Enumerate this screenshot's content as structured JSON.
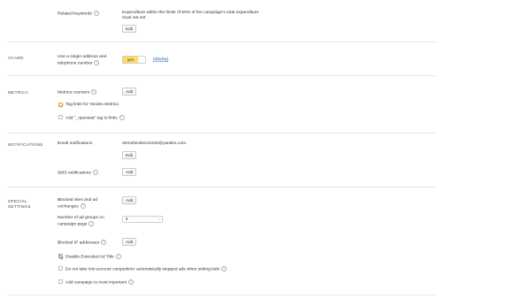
{
  "related_keywords": {
    "label": "Related keywords",
    "desc_line1": "Expenditure within the limits of 50% of the campaign's total expenditure",
    "desc_line2": "Goal not set",
    "edit_button": "Edit"
  },
  "vcard": {
    "section": "VCARD",
    "label_line1": "Use a single address and",
    "label_line2": "telephone number",
    "toggle_value": "yes",
    "link": "(display)"
  },
  "metrica": {
    "section": "METRICA",
    "counters_label": "Metrica counters",
    "add_button": "Add",
    "tag_links_label": "Tag links for Yandex.Metrica",
    "tag_links_checked": true,
    "openstat_label": "Add \"_openstat\" tag to links",
    "openstat_checked": false
  },
  "notifications": {
    "section": "NOTIFICATIONS",
    "email_label": "Email notifications",
    "email_value": "demofordirect1234@yandex.com",
    "edit_button": "Edit",
    "sms_label": "SMS notifications",
    "add_button": "Add"
  },
  "special": {
    "section_line1": "SPECIAL",
    "section_line2": "SETTINGS",
    "blocked_sites_line1": "Blocked sites and ad",
    "blocked_sites_line2": "exchanges",
    "blocked_sites_button": "Add",
    "ad_groups_line1": "Number of ad groups on",
    "ad_groups_line2": "campaign page",
    "ad_groups_value": "5",
    "blocked_ip_label": "Blocked IP addresses",
    "blocked_ip_button": "Add",
    "disable_extended_label": "Disable Extended Ad Title",
    "competitors_label": "Do not take into account competitors' automatically stopped ads when setting bids",
    "most_important_label": "Add campaign to most important"
  },
  "colors": {
    "toggle_on": "#ffdc5e",
    "link": "#2a57b5",
    "check_mark": "#d49a1b"
  }
}
